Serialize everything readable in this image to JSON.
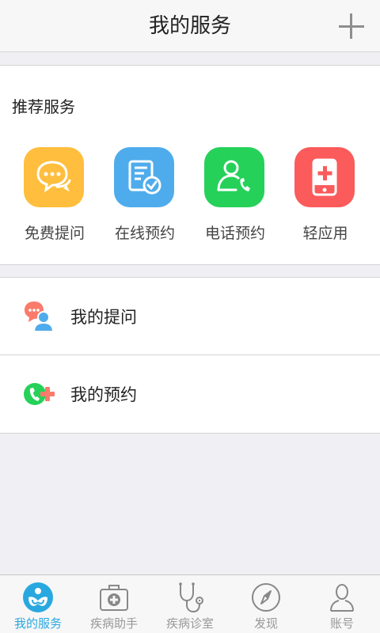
{
  "header": {
    "title": "我的服务",
    "add_icon": "plus-icon"
  },
  "recommended": {
    "title": "推荐服务",
    "items": [
      {
        "label": "免费提问",
        "icon": "chat-bubbles-icon",
        "color": "#ffbe3d"
      },
      {
        "label": "在线预约",
        "icon": "calendar-check-icon",
        "color": "#4facec"
      },
      {
        "label": "电话预约",
        "icon": "phone-user-icon",
        "color": "#26d15a"
      },
      {
        "label": "轻应用",
        "icon": "mobile-plus-icon",
        "color": "#fb5b5b"
      }
    ]
  },
  "my_list": {
    "items": [
      {
        "label": "我的提问",
        "icon": "question-user-icon"
      },
      {
        "label": "我的预约",
        "icon": "phone-plus-icon"
      }
    ]
  },
  "tabbar": {
    "active_color": "#29a8e0",
    "items": [
      {
        "label": "我的服务",
        "icon": "my-service-icon",
        "active": true
      },
      {
        "label": "疾病助手",
        "icon": "medical-kit-icon",
        "active": false
      },
      {
        "label": "疾病诊室",
        "icon": "stethoscope-icon",
        "active": false
      },
      {
        "label": "发现",
        "icon": "compass-icon",
        "active": false
      },
      {
        "label": "账号",
        "icon": "person-icon",
        "active": false
      }
    ]
  }
}
